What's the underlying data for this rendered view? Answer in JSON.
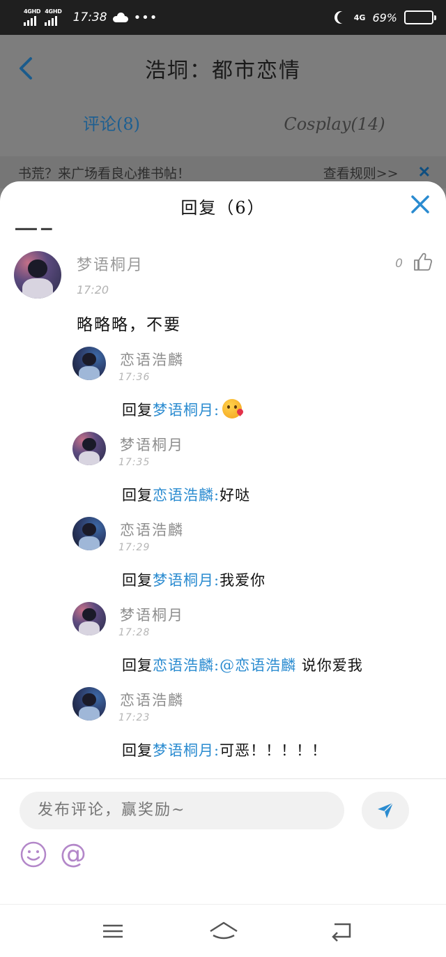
{
  "status_bar": {
    "network_1": "4GHD",
    "network_2": "4GHD",
    "time": "17:38",
    "dots": "•••",
    "network_type": "4G",
    "battery": "69%"
  },
  "background": {
    "title": "浩垌：都市恋情",
    "tabs": [
      {
        "label": "评论(8)"
      },
      {
        "label": "Cosplay(14)"
      }
    ],
    "notice": "书荒？来广场看良心推书帖！",
    "notice_link": "查看规则>>",
    "notice_close": "✕"
  },
  "sheet": {
    "title": "回复（6）",
    "main_comment": {
      "user": "梦语桐月",
      "time": "17:20",
      "likes": "0",
      "content": "略略略，不要"
    },
    "replies": [
      {
        "user": "恋语浩麟",
        "time": "17:36",
        "prefix": "回复",
        "to": "梦语桐月",
        "sep": ":",
        "text": "",
        "has_emoji": true
      },
      {
        "user": "梦语桐月",
        "time": "17:35",
        "prefix": "回复",
        "to": "恋语浩麟",
        "sep": ":",
        "text": "好哒"
      },
      {
        "user": "恋语浩麟",
        "time": "17:29",
        "prefix": "回复",
        "to": "梦语桐月",
        "sep": ":",
        "text": "我爱你"
      },
      {
        "user": "梦语桐月",
        "time": "17:28",
        "prefix": "回复",
        "to": "恋语浩麟",
        "sep": ":",
        "mention": "@恋语浩麟",
        "text": " 说你爱我"
      },
      {
        "user": "恋语浩麟",
        "time": "17:23",
        "prefix": "回复",
        "to": "梦语桐月",
        "sep": ":",
        "text": "可恶！！！！！"
      }
    ]
  },
  "input": {
    "placeholder": "发布评论，赢奖励~",
    "at_symbol": "@"
  },
  "colors": {
    "accent": "#2a8bd0",
    "icon_purple": "#b387c9"
  }
}
